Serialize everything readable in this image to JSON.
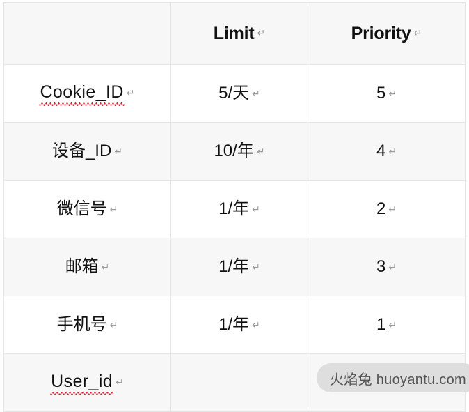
{
  "document": {
    "type": "word-processor-table",
    "page_background": "#ffffff",
    "table": {
      "header_background": "#f7f7f7",
      "stripe_background": "#f7f7f7",
      "row_background": "#ffffff",
      "border_color": "#e4e4e4",
      "columns": [
        {
          "key": "field",
          "label": ""
        },
        {
          "key": "limit",
          "label": "Limit"
        },
        {
          "key": "priority",
          "label": "Priority"
        }
      ],
      "rows": [
        {
          "field": "Cookie_ID",
          "field_misspelled": true,
          "limit": "5/天",
          "priority": "5"
        },
        {
          "field": "设备_ID",
          "field_misspelled": false,
          "limit": "10/年",
          "priority": "4"
        },
        {
          "field": "微信号",
          "field_misspelled": false,
          "limit": "1/年",
          "priority": "2"
        },
        {
          "field": "邮箱",
          "field_misspelled": false,
          "limit": "1/年",
          "priority": "3"
        },
        {
          "field": "手机号",
          "field_misspelled": false,
          "limit": "1/年",
          "priority": "1"
        },
        {
          "field": "User_id",
          "field_misspelled": true,
          "limit": "",
          "priority": ""
        }
      ]
    },
    "marks": {
      "paragraph_return": "↵"
    },
    "watermark": {
      "text": "火焰兔 huoyantu.com",
      "background": "#dedede",
      "text_color": "#555555"
    }
  }
}
